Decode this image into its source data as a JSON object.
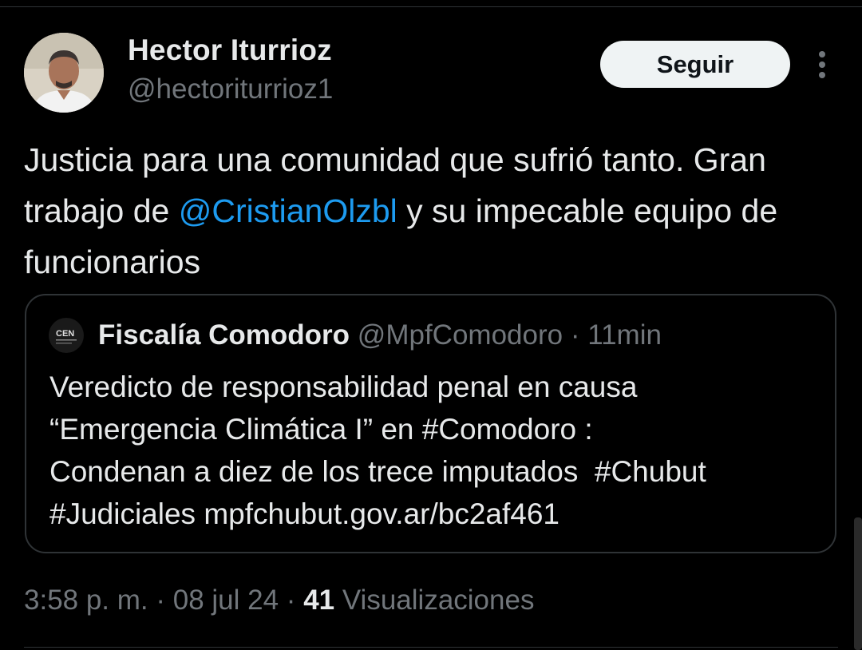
{
  "author": {
    "name": "Hector Iturrioz",
    "handle": "@hectoriturrioz1"
  },
  "follow_label": "Seguir",
  "tweet": {
    "text_before": "Justicia para una comunidad que sufrió tanto. Gran trabajo de ",
    "mention": "@CristianOlzbl",
    "text_after": " y su impecable equipo de funcionarios"
  },
  "quote": {
    "avatar_label": "CEN",
    "author_name": "Fiscalía Comodoro",
    "author_handle": "@MpfComodoro",
    "separator": " · ",
    "time": "11min",
    "lines": [
      "Veredicto de responsabilidad penal en causa",
      "“Emergencia Climática I” en #Comodoro :",
      "Condenan a diez de los trece imputados  #Chubut",
      "#Judiciales mpfchubut.gov.ar/bc2af461"
    ]
  },
  "meta": {
    "time": "3:58 p. m.",
    "separator": " · ",
    "date": "08 jul 24",
    "views_count": "41",
    "views_label": " Visualizaciones"
  },
  "colors": {
    "background": "#000000",
    "text": "#e7e9ea",
    "secondary": "#71767b",
    "link": "#1d9bf0",
    "border": "#2f3336"
  },
  "icons": {
    "more": "more-vertical-icon"
  }
}
